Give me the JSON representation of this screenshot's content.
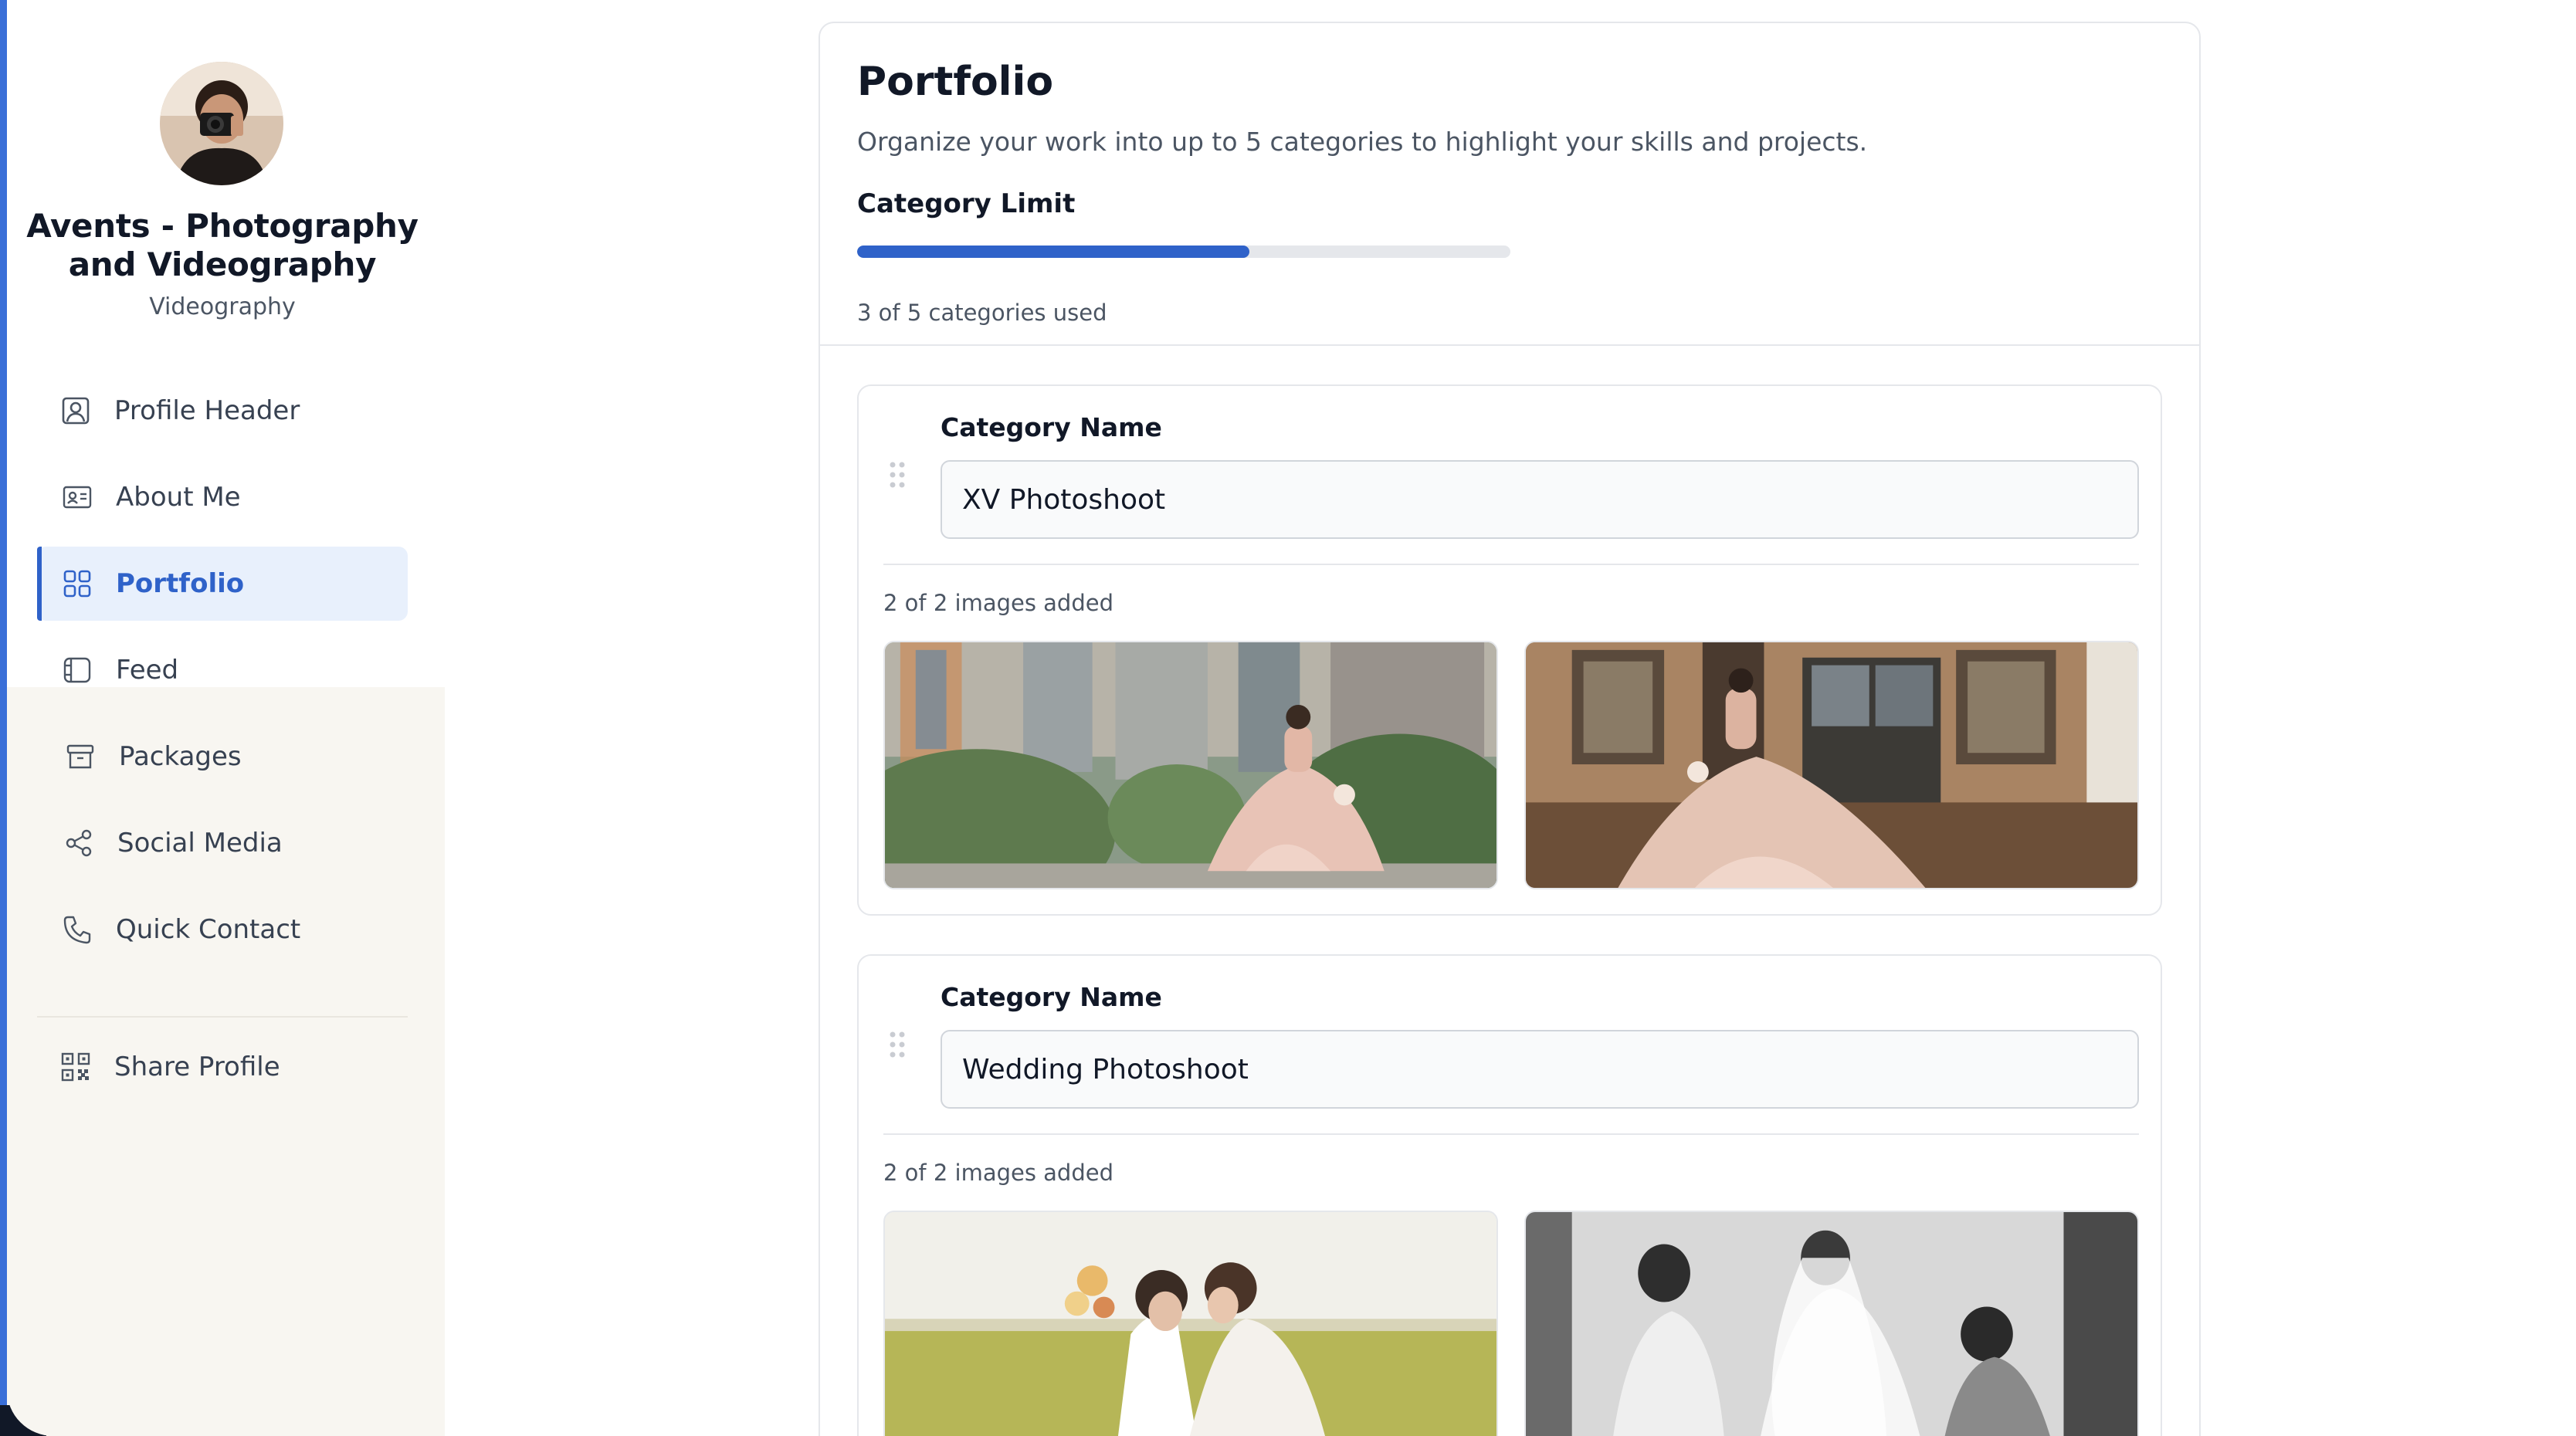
{
  "sidebar": {
    "profile_name": "Avents - Photography and Videography",
    "profile_category": "Videography",
    "items": [
      {
        "label": "Profile Header",
        "icon": "user-square-icon"
      },
      {
        "label": "About Me",
        "icon": "id-card-icon"
      },
      {
        "label": "Portfolio",
        "icon": "grid-icon",
        "active": true
      },
      {
        "label": "Feed",
        "icon": "feed-icon"
      },
      {
        "label": "Packages",
        "icon": "archive-box-icon"
      },
      {
        "label": "Social Media",
        "icon": "share-icon"
      },
      {
        "label": "Quick Contact",
        "icon": "phone-icon"
      }
    ],
    "share_label": "Share Profile",
    "share_icon": "qr-code-icon"
  },
  "portfolio": {
    "title": "Portfolio",
    "subtitle": "Organize your work into up to 5 categories to highlight your skills and projects.",
    "limit_label": "Category Limit",
    "limit_used": 3,
    "limit_max": 5,
    "limit_text": "3 of 5 categories used",
    "categories": [
      {
        "name_label": "Category Name",
        "name": "XV Photoshoot",
        "images_text": "2 of 2 images added"
      },
      {
        "name_label": "Category Name",
        "name": "Wedding Photoshoot",
        "images_text": "2 of 2 images added"
      }
    ]
  },
  "colors": {
    "accent": "#2f62c9",
    "active_bg": "#e8f0fc",
    "sidebar_lower_bg": "#f8f6f1"
  }
}
